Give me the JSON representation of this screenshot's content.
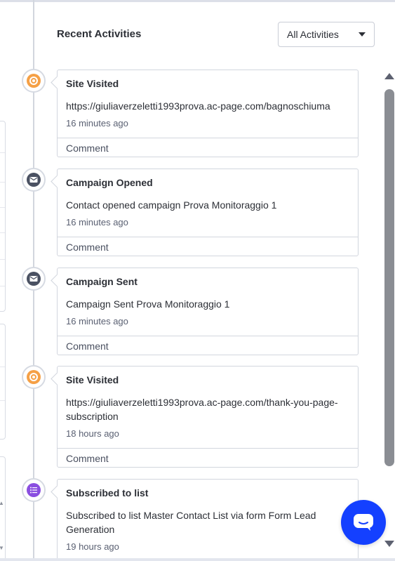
{
  "header": {
    "title": "Recent Activities",
    "filter": {
      "selected": "All Activities"
    }
  },
  "activities": [
    {
      "type": "site",
      "title": "Site Visited",
      "description": "https://giuliaverzeletti1993prova.ac-page.com/bagnoschiuma",
      "time": "16 minutes ago",
      "comment_label": "Comment"
    },
    {
      "type": "campaign",
      "title": "Campaign Opened",
      "description": "Contact opened campaign Prova Monitoraggio 1",
      "time": "16 minutes ago",
      "comment_label": "Comment"
    },
    {
      "type": "campaign",
      "title": "Campaign Sent",
      "description": "Campaign Sent Prova Monitoraggio 1",
      "time": "16 minutes ago",
      "comment_label": "Comment"
    },
    {
      "type": "site",
      "title": "Site Visited",
      "description": "https://giuliaverzeletti1993prova.ac-page.com/thank-you-page-subscription",
      "time": "18 hours ago",
      "comment_label": "Comment"
    },
    {
      "type": "list",
      "title": "Subscribed to list",
      "description": "Subscribed to list Master Contact List via form Form Lead Generation",
      "time": "19 hours ago"
    }
  ],
  "colors": {
    "site_icon": "#f5a046",
    "campaign_icon": "#4a5162",
    "list_icon": "#8a4ee0",
    "chat_button": "#1440ff"
  }
}
